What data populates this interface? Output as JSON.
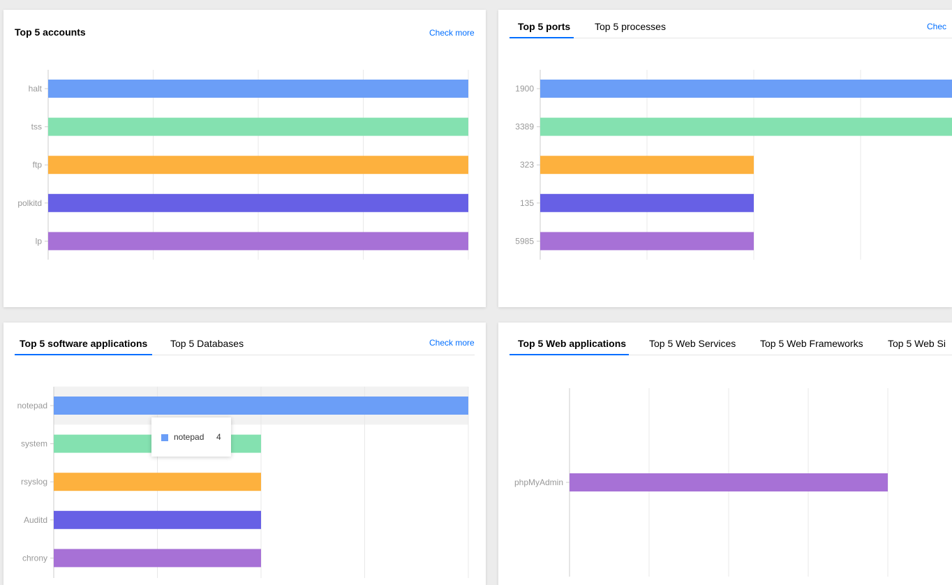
{
  "colors": {
    "link": "#006eff",
    "grid": "#e8e8e8",
    "axis_label": "#999999",
    "hover_band": "#f2f2f2"
  },
  "accounts": {
    "title": "Top 5 accounts",
    "check_more": "Check more"
  },
  "ports": {
    "tabs": [
      {
        "label": "Top 5 ports",
        "active": true
      },
      {
        "label": "Top 5 processes",
        "active": false
      }
    ],
    "check_more": "Chec"
  },
  "software": {
    "tabs": [
      {
        "label": "Top 5 software applications",
        "active": true
      },
      {
        "label": "Top 5 Databases",
        "active": false
      }
    ],
    "check_more": "Check more",
    "tooltip": {
      "name": "notepad",
      "value": "4",
      "color": "#6b9ef7"
    }
  },
  "web": {
    "tabs": [
      {
        "label": "Top 5 Web applications",
        "active": true
      },
      {
        "label": "Top 5 Web Services",
        "active": false
      },
      {
        "label": "Top 5 Web Frameworks",
        "active": false
      },
      {
        "label": "Top 5 Web Si",
        "active": false
      }
    ]
  },
  "chart_data": [
    {
      "id": "accounts",
      "type": "bar",
      "orientation": "horizontal",
      "categories": [
        "halt",
        "tss",
        "ftp",
        "polkitd",
        "lp"
      ],
      "values": [
        4,
        4,
        4,
        4,
        4
      ],
      "colors": [
        "#6b9ef7",
        "#84e1b0",
        "#fdb13e",
        "#6760e5",
        "#a771d6"
      ],
      "xlim": [
        0,
        4
      ],
      "grid": true
    },
    {
      "id": "ports",
      "type": "bar",
      "orientation": "horizontal",
      "categories": [
        "1900",
        "3389",
        "323",
        "135",
        "5985"
      ],
      "values": [
        4,
        4,
        2,
        2,
        2
      ],
      "colors": [
        "#6b9ef7",
        "#84e1b0",
        "#fdb13e",
        "#6760e5",
        "#a771d6"
      ],
      "xlim": [
        0,
        4
      ],
      "grid": true
    },
    {
      "id": "software",
      "type": "bar",
      "orientation": "horizontal",
      "categories": [
        "notepad",
        "system",
        "rsyslog",
        "Auditd",
        "chrony"
      ],
      "values": [
        4,
        2,
        2,
        2,
        2
      ],
      "colors": [
        "#6b9ef7",
        "#84e1b0",
        "#fdb13e",
        "#6760e5",
        "#a771d6"
      ],
      "xlim": [
        0,
        4
      ],
      "grid": true,
      "highlighted": "notepad"
    },
    {
      "id": "web",
      "type": "bar",
      "orientation": "horizontal",
      "categories": [
        "phpMyAdmin"
      ],
      "values": [
        4
      ],
      "colors": [
        "#a771d6"
      ],
      "xlim": [
        0,
        4
      ],
      "grid": true
    }
  ]
}
